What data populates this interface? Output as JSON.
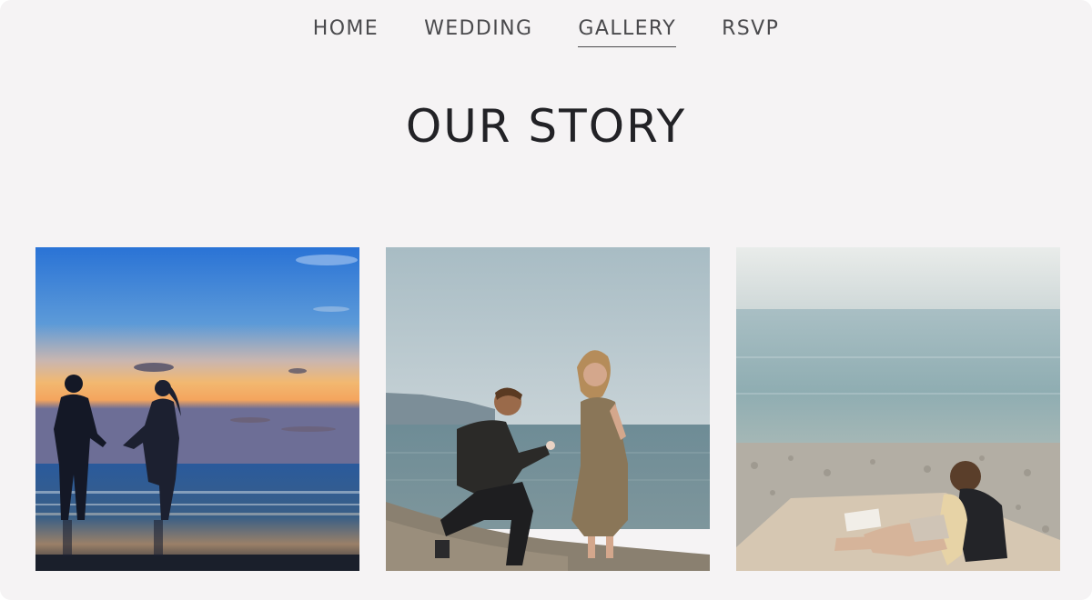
{
  "nav": {
    "items": [
      {
        "label": "HOME",
        "active": false
      },
      {
        "label": "WEDDING",
        "active": false
      },
      {
        "label": "GALLERY",
        "active": true
      },
      {
        "label": "RSVP",
        "active": false
      }
    ]
  },
  "page": {
    "title": "OUR STORY"
  },
  "gallery": {
    "photos": [
      {
        "subject": "couple holding hands silhouetted on beach at sunset"
      },
      {
        "subject": "man kneeling proposing with ring to woman on pebble beach"
      },
      {
        "subject": "couple lying on blanket on pebble beach facing the sea"
      }
    ]
  }
}
